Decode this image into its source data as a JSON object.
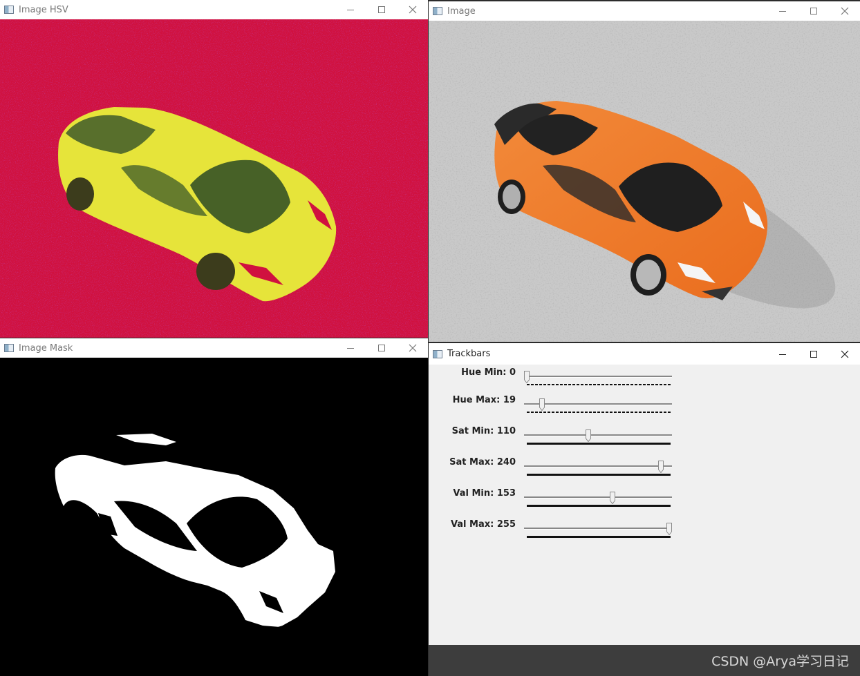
{
  "windows": {
    "hsv": {
      "title": "Image HSV"
    },
    "image": {
      "title": "Image"
    },
    "mask": {
      "title": "Image Mask"
    },
    "trackbars": {
      "title": "Trackbars"
    }
  },
  "trackbars": [
    {
      "label": "Hue Min: 0",
      "value": 0,
      "max": 179,
      "bar_style": "dashed"
    },
    {
      "label": "Hue Max: 19",
      "value": 19,
      "max": 179,
      "bar_style": "dashed"
    },
    {
      "label": "Sat Min: 110",
      "value": 110,
      "max": 255,
      "bar_style": "solid"
    },
    {
      "label": "Sat Max: 240",
      "value": 240,
      "max": 255,
      "bar_style": "solid"
    },
    {
      "label": "Val Min: 153",
      "value": 153,
      "max": 255,
      "bar_style": "solid"
    },
    {
      "label": "Val Max: 255",
      "value": 255,
      "max": 255,
      "bar_style": "solid"
    }
  ],
  "watermark": "CSDN @Arya学习日记",
  "colors": {
    "hsv_background": "#d0113f",
    "hsv_car": "#e6e43a",
    "photo_carpet": "#c9c9c9",
    "car_orange": "#f07a2a",
    "mask_background": "#000000",
    "mask_foreground": "#ffffff",
    "trackbar_panel": "#f0f0f0"
  },
  "icons": [
    "minimize-icon",
    "maximize-icon",
    "close-icon",
    "window-app-icon"
  ]
}
